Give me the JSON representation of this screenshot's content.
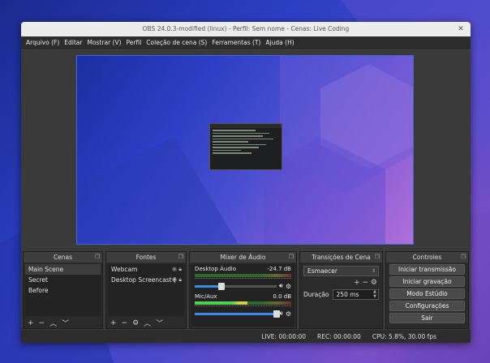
{
  "window": {
    "title": "OBS 24.0.3-modified (linux) - Perfil: Sem nome - Cenas: Live Coding",
    "close_glyph": "✕"
  },
  "menu": [
    "Arquivo (F)",
    "Editar",
    "Mostrar (V)",
    "Perfil",
    "Coleção de cena (S)",
    "Ferramentas (T)",
    "Ajuda (H)"
  ],
  "docks": {
    "scenes": {
      "title": "Cenas",
      "items": [
        "Main Scene",
        "Secret",
        "Before"
      ],
      "selected": 0
    },
    "sources": {
      "title": "Fontes",
      "items": [
        "Webcam",
        "Desktop Screencast ("
      ]
    },
    "mixer": {
      "title": "Mixer de Áudio",
      "channels": [
        {
          "name": "Desktop Áudio",
          "db": "-24.7 dB",
          "level": 0.0,
          "volume": 0.33
        },
        {
          "name": "Mic/Aux",
          "db": "0.0 dB",
          "level": 0.55,
          "volume": 1.0
        }
      ]
    },
    "transitions": {
      "title": "Transições de Cena",
      "selected": "Esmaecer",
      "duration_label": "Duração",
      "duration_value": "250 ms"
    },
    "controls": {
      "title": "Controles",
      "buttons": [
        "Iniciar transmissão",
        "Iniciar gravação",
        "Modo Estúdio",
        "Configurações",
        "Sair"
      ]
    }
  },
  "status": {
    "live": "LIVE: 00:00:00",
    "rec": "REC: 00:00:00",
    "cpu": "CPU: 5.8%, 30.00 fps"
  },
  "colors": {
    "accent": "#3a8ee6",
    "preview_border": "#3a6ad8"
  }
}
